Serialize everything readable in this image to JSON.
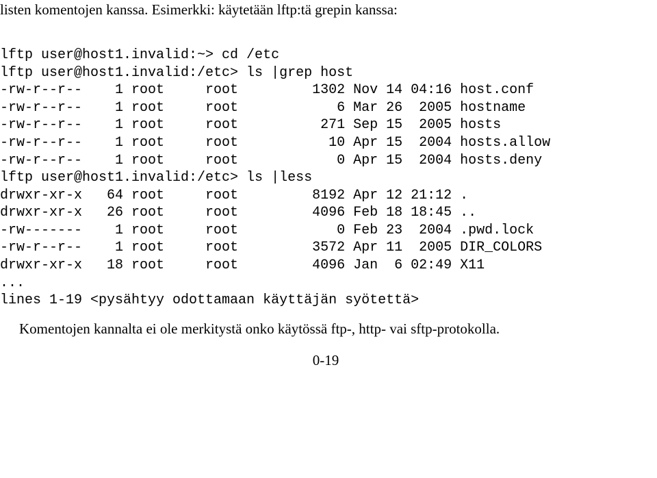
{
  "intro_line": "listen komentojen kanssa. Esimerkki: käytetään lftp:tä grepin kanssa:",
  "term1": {
    "l1": "lftp user@host1.invalid:~> cd /etc",
    "l2": "lftp user@host1.invalid:/etc> ls |grep host",
    "l3": "-rw-r--r--    1 root     root         1302 Nov 14 04:16 host.conf",
    "l4": "-rw-r--r--    1 root     root            6 Mar 26  2005 hostname",
    "l5": "-rw-r--r--    1 root     root          271 Sep 15  2005 hosts",
    "l6": "-rw-r--r--    1 root     root           10 Apr 15  2004 hosts.allow",
    "l7": "-rw-r--r--    1 root     root            0 Apr 15  2004 hosts.deny",
    "l8": "lftp user@host1.invalid:/etc> ls |less",
    "l9": "drwxr-xr-x   64 root     root         8192 Apr 12 21:12 .",
    "l10": "drwxr-xr-x   26 root     root         4096 Feb 18 18:45 ..",
    "l11": "-rw-------    1 root     root            0 Feb 23  2004 .pwd.lock",
    "l12": "-rw-r--r--    1 root     root         3572 Apr 11  2005 DIR_COLORS",
    "l13": "drwxr-xr-x   18 root     root         4096 Jan  6 02:49 X11",
    "l14": "...",
    "l15": "lines 1-19 <pysähtyy odottamaan käyttäjän syötettä>"
  },
  "outro_line": "Komentojen kannalta ei ole merkitystä onko käytössä ftp-, http- vai sftp-protokolla.",
  "page_number": "0-19"
}
